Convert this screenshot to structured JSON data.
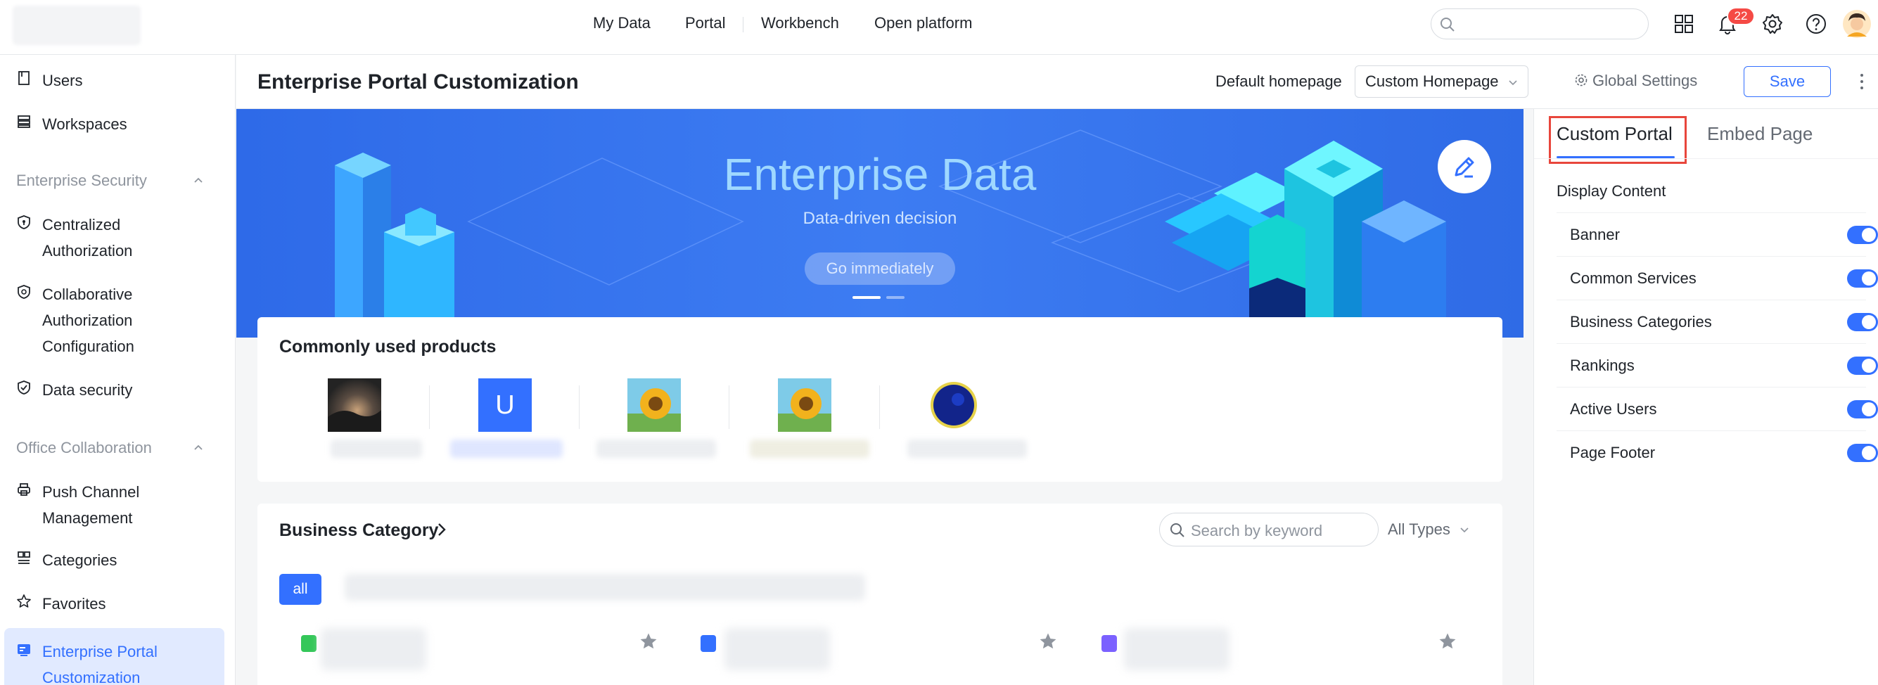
{
  "topnav": {
    "items": [
      "My Data",
      "Portal",
      "Workbench",
      "Open platform"
    ],
    "notifications_count": "22"
  },
  "sidebar": {
    "items": [
      {
        "label": "Users",
        "icon": "book-icon"
      },
      {
        "label": "Workspaces",
        "icon": "stack-icon"
      }
    ],
    "section_security": "Enterprise Security",
    "security_items": [
      {
        "line1": "Centralized",
        "line2": "Authorization",
        "icon": "shield-icon"
      },
      {
        "line1": "Collaborative",
        "line2": "Authorization",
        "line3": "Configuration",
        "icon": "shield-gear-icon"
      },
      {
        "line1": "Data security",
        "icon": "shield-check-icon"
      }
    ],
    "section_office": "Office Collaboration",
    "office_items": [
      {
        "line1": "Push Channel",
        "line2": "Management",
        "icon": "printer-icon"
      },
      {
        "line1": "Categories",
        "icon": "category-icon"
      },
      {
        "line1": "Favorites",
        "icon": "star-outline-icon"
      }
    ],
    "active_item": {
      "line1": "Enterprise Portal",
      "line2": "Customization",
      "icon": "portal-icon"
    }
  },
  "header": {
    "title": "Enterprise Portal Customization",
    "default_homepage_label": "Default homepage",
    "default_homepage_value": "Custom Homepage",
    "global_settings": "Global Settings",
    "save": "Save"
  },
  "banner": {
    "title": "Enterprise Data",
    "subtitle": "Data-driven decision",
    "button": "Go immediately"
  },
  "products": {
    "title": "Commonly used products",
    "items": [
      {
        "type": "image-dark"
      },
      {
        "type": "letter",
        "letter": "U"
      },
      {
        "type": "image-sunflower"
      },
      {
        "type": "image-sunflower"
      },
      {
        "type": "image-eclipse"
      }
    ]
  },
  "business_category": {
    "title": "Business Category",
    "search_placeholder": "Search by keyword",
    "types": "All Types",
    "all_chip": "all"
  },
  "right_panel": {
    "tabs": [
      "Custom Portal",
      "Embed Page"
    ],
    "display_content": "Display Content",
    "rows": [
      "Banner",
      "Common Services",
      "Business Categories",
      "Rankings",
      "Active Users",
      "Page Footer"
    ],
    "accent_color": "#3370ff",
    "highlight_color": "#e8463c"
  }
}
